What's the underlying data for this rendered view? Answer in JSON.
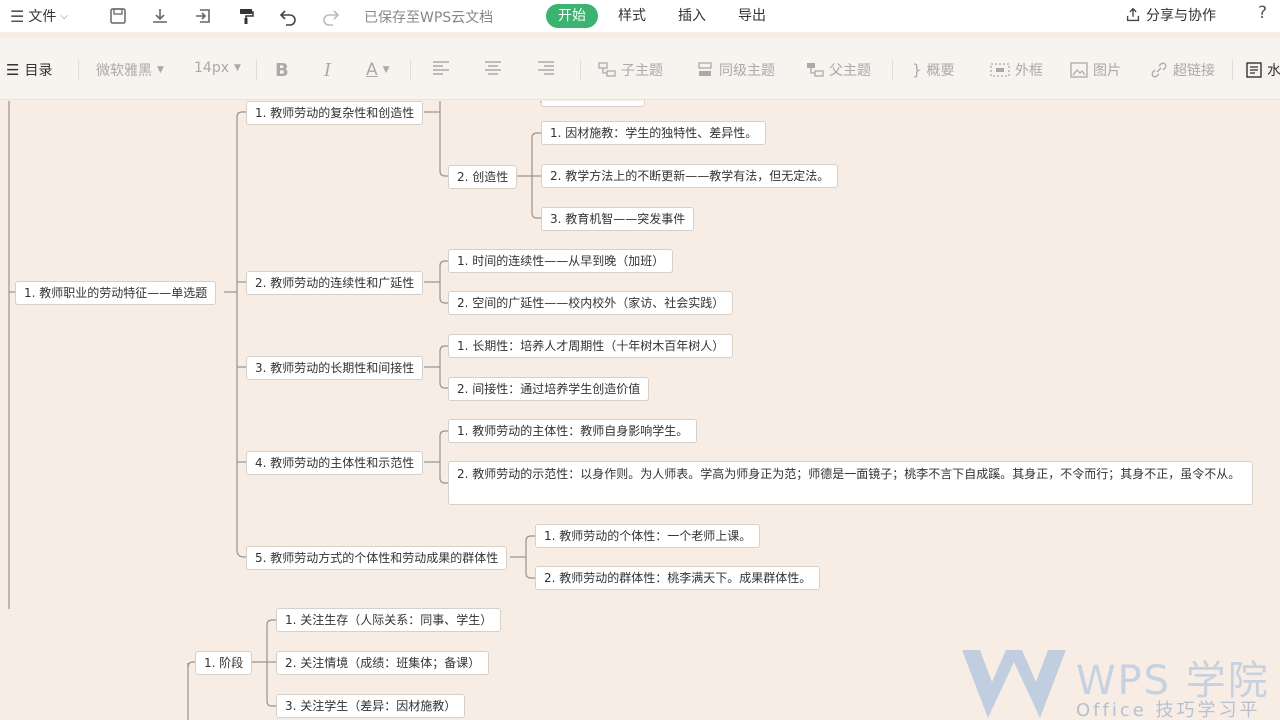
{
  "topbar": {
    "file_menu": "文件",
    "saved_status": "已保存至WPS云文档",
    "tabs": [
      {
        "label": "开始",
        "active": true
      },
      {
        "label": "样式",
        "active": false
      },
      {
        "label": "插入",
        "active": false
      },
      {
        "label": "导出",
        "active": false
      }
    ],
    "share_label": "分享与协作",
    "help_label": "?"
  },
  "toolbar": {
    "outline_label": "目录",
    "font_family": "微软雅黑",
    "font_size": "14px",
    "bold": "B",
    "italic": "I",
    "font_color": "A",
    "child_topic": "子主题",
    "sibling_topic": "同级主题",
    "parent_topic": "父主题",
    "summary": "概要",
    "frame": "外框",
    "image": "图片",
    "hyperlink": "超链接",
    "watermark_partial": "水"
  },
  "mindmap": {
    "root": "1. 教师职业的劳动特征——单选题",
    "branches": [
      {
        "label": "1. 教师劳动的复杂性和创造性"
      },
      {
        "label": "2. 教师劳动的连续性和广延性"
      },
      {
        "label": "3. 教师劳动的长期性和间接性"
      },
      {
        "label": "4. 教师劳动的主体性和示范性"
      },
      {
        "label": "5. 教师劳动方式的个体性和劳动成果的群体性"
      }
    ],
    "creativity": "2. 创造性",
    "creativity_children": [
      "1. 因材施教：学生的独特性、差异性。",
      "2. 教学方法上的不断更新——教学有法，但无定法。",
      "3. 教育机智——突发事件"
    ],
    "continuity_children": [
      "1. 时间的连续性——从早到晚（加班）",
      "2. 空间的广延性——校内校外（家访、社会实践）"
    ],
    "longterm_children": [
      "1. 长期性：培养人才周期性（十年树木百年树人）",
      "2. 间接性：通过培养学生创造价值"
    ],
    "subject_children": [
      "1. 教师劳动的主体性：教师自身影响学生。",
      "2. 教师劳动的示范性：以身作则。为人师表。学高为师身正为范；师德是一面镜子；桃李不言下自成蹊。其身正，不令而行；其身不正，虽令不从。"
    ],
    "individual_children": [
      "1. 教师劳动的个体性：一个老师上课。",
      "2. 教师劳动的群体性：桃李满天下。成果群体性。"
    ],
    "stage": "1. 阶段",
    "stage_children": [
      "1. 关注生存（人际关系：同事、学生）",
      "2. 关注情境（成绩：班集体；备课）",
      "3. 关注学生（差异：因材施教）"
    ]
  },
  "watermark": {
    "brand": "WPS 学院",
    "tagline": "Office 技巧学习平台"
  },
  "colors": {
    "accent": "#3cb371",
    "canvas_bg": "#f7ede4",
    "line": "#9a928c"
  }
}
